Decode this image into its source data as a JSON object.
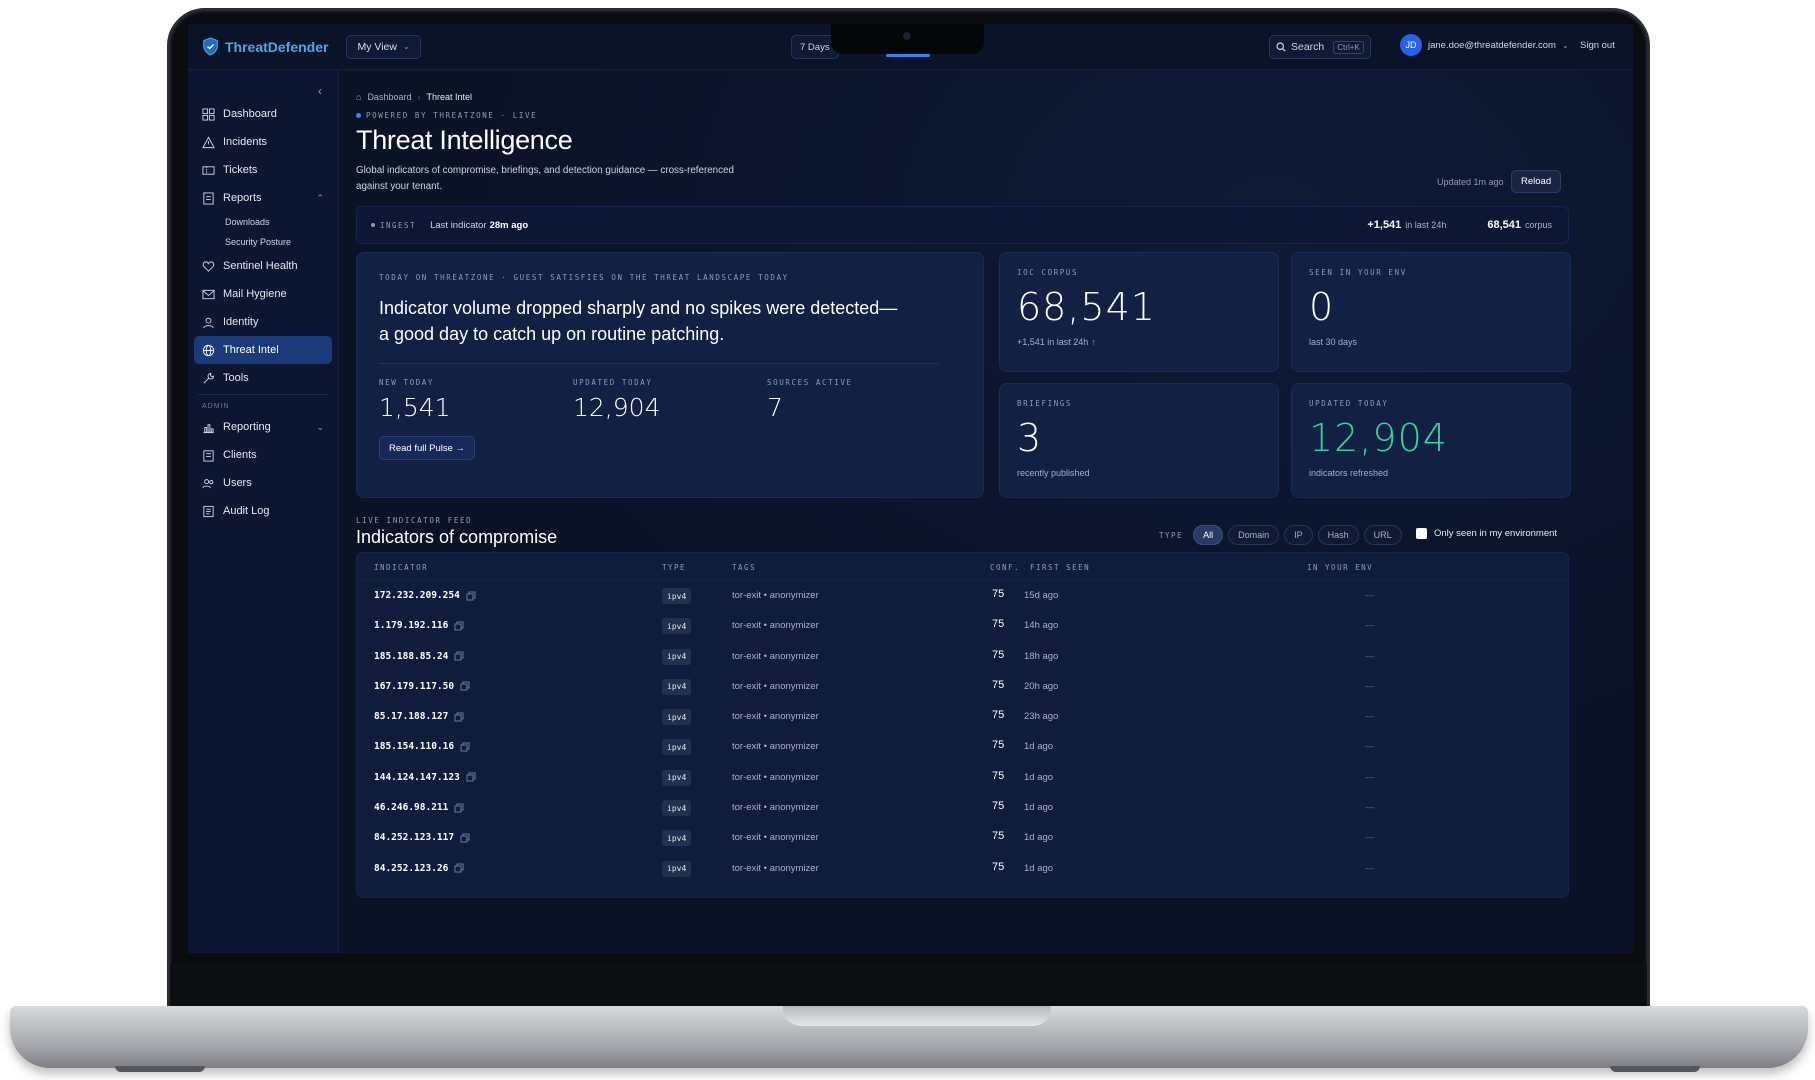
{
  "topbar": {
    "brand": "ThreatDefender",
    "view_label": "My View",
    "range_label": "7 Days",
    "search_label": "Search",
    "search_shortcut": "Ctrl+K",
    "user_initials": "JD",
    "user_email": "jane.doe@threatdefender.com",
    "signout_label": "Sign out"
  },
  "sidebar": {
    "items": [
      {
        "label": "Dashboard",
        "icon": "grid-icon"
      },
      {
        "label": "Incidents",
        "icon": "warning-icon"
      },
      {
        "label": "Tickets",
        "icon": "ticket-icon"
      },
      {
        "label": "Reports",
        "icon": "report-icon"
      },
      {
        "label": "Sentinel Health",
        "icon": "heart-icon"
      },
      {
        "label": "Mail Hygiene",
        "icon": "mail-icon"
      },
      {
        "label": "Identity",
        "icon": "identity-icon"
      },
      {
        "label": "Threat Intel",
        "icon": "globe-icon"
      },
      {
        "label": "Tools",
        "icon": "wrench-icon"
      }
    ],
    "report_subitems": [
      "Downloads",
      "Security Posture"
    ],
    "admin_section": "ADMIN",
    "admin_items": [
      {
        "label": "Reporting",
        "icon": "chart-icon"
      },
      {
        "label": "Clients",
        "icon": "clients-icon"
      },
      {
        "label": "Users",
        "icon": "users-icon"
      },
      {
        "label": "Audit Log",
        "icon": "log-icon"
      }
    ]
  },
  "page": {
    "breadcrumb_root": "Dashboard",
    "breadcrumb_current": "Threat Intel",
    "powered": "POWERED BY THREATZONE · LIVE",
    "title": "Threat Intelligence",
    "subtitle": "Global indicators of compromise, briefings, and detection guidance — cross-referenced against your tenant.",
    "updated": "Updated 1m ago",
    "reload_label": "Reload"
  },
  "ingest": {
    "tag": "INGEST",
    "last_label": "Last indicator",
    "last_value": "28m ago",
    "delta_value": "+1,541",
    "delta_label": "in last 24h",
    "corpus_value": "68,541",
    "corpus_label": "corpus"
  },
  "pulse": {
    "kicker": "TODAY ON THREATZONE · GUEST SATISFIES ON THE THREAT LANDSCAPE TODAY",
    "headline": "Indicator volume dropped sharply and no spikes were detected—a good day to catch up on routine patching.",
    "stats": [
      {
        "label": "NEW TODAY",
        "value": "1,541"
      },
      {
        "label": "UPDATED TODAY",
        "value": "12,904"
      },
      {
        "label": "SOURCES ACTIVE",
        "value": "7"
      }
    ],
    "cta": "Read full Pulse →"
  },
  "stats": {
    "corpus": {
      "label": "IOC CORPUS",
      "value": "68,541",
      "caption": "+1,541 in last 24h",
      "trend": "↑"
    },
    "seen": {
      "label": "SEEN IN YOUR ENV",
      "value": "0",
      "caption": "last 30 days"
    },
    "briefings": {
      "label": "BRIEFINGS",
      "value": "3",
      "caption": "recently published"
    },
    "updated": {
      "label": "UPDATED TODAY",
      "value": "12,904",
      "caption": "indicators refreshed"
    }
  },
  "feed": {
    "kicker": "LIVE INDICATOR FEED",
    "title": "Indicators of compromise",
    "type_label": "TYPE",
    "filters": [
      "All",
      "Domain",
      "IP",
      "Hash",
      "URL"
    ],
    "only_env_label": "Only seen in my environment",
    "columns": [
      "INDICATOR",
      "TYPE",
      "TAGS",
      "CONF.",
      "FIRST SEEN",
      "IN YOUR ENV"
    ],
    "rows": [
      {
        "indicator": "172.232.209.254",
        "type": "ipv4",
        "tags": "tor-exit • anonymizer",
        "conf": "75",
        "first_seen": "15d ago",
        "env": "—"
      },
      {
        "indicator": "1.179.192.116",
        "type": "ipv4",
        "tags": "tor-exit • anonymizer",
        "conf": "75",
        "first_seen": "14h ago",
        "env": "—"
      },
      {
        "indicator": "185.188.85.24",
        "type": "ipv4",
        "tags": "tor-exit • anonymizer",
        "conf": "75",
        "first_seen": "18h ago",
        "env": "—"
      },
      {
        "indicator": "167.179.117.50",
        "type": "ipv4",
        "tags": "tor-exit • anonymizer",
        "conf": "75",
        "first_seen": "20h ago",
        "env": "—"
      },
      {
        "indicator": "85.17.188.127",
        "type": "ipv4",
        "tags": "tor-exit • anonymizer",
        "conf": "75",
        "first_seen": "23h ago",
        "env": "—"
      },
      {
        "indicator": "185.154.110.16",
        "type": "ipv4",
        "tags": "tor-exit • anonymizer",
        "conf": "75",
        "first_seen": "1d ago",
        "env": "—"
      },
      {
        "indicator": "144.124.147.123",
        "type": "ipv4",
        "tags": "tor-exit • anonymizer",
        "conf": "75",
        "first_seen": "1d ago",
        "env": "—"
      },
      {
        "indicator": "46.246.98.211",
        "type": "ipv4",
        "tags": "tor-exit • anonymizer",
        "conf": "75",
        "first_seen": "1d ago",
        "env": "—"
      },
      {
        "indicator": "84.252.123.117",
        "type": "ipv4",
        "tags": "tor-exit • anonymizer",
        "conf": "75",
        "first_seen": "1d ago",
        "env": "—"
      },
      {
        "indicator": "84.252.123.26",
        "type": "ipv4",
        "tags": "tor-exit • anonymizer",
        "conf": "75",
        "first_seen": "1d ago",
        "env": "—"
      }
    ]
  },
  "colors": {
    "accent": "#3b82f6",
    "positive": "#34d399",
    "background": "#0a1226",
    "active_nav": "#1b3a7a"
  }
}
